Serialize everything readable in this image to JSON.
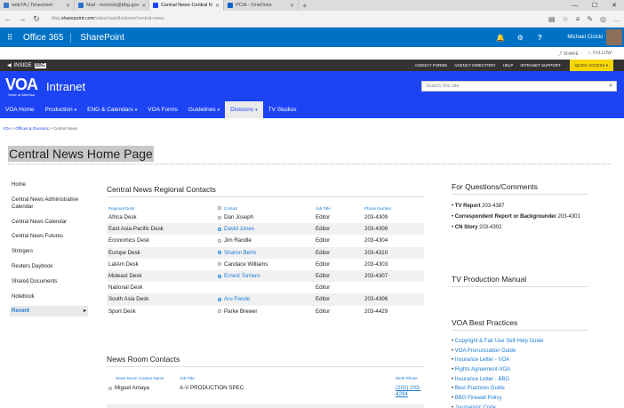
{
  "browser": {
    "tabs": [
      {
        "label": "webTA | Timesheet",
        "color": "#3c78c8"
      },
      {
        "label": "Mail - mcicicki@bbg.gov",
        "color": "#2a6fc9"
      },
      {
        "label": "Central News Central N",
        "color": "#1c44f5",
        "active": true
      },
      {
        "label": "PCIA - OneDrive",
        "color": "#0a64c8"
      }
    ],
    "url_prefix": "bbg.",
    "url_domain": "sharepoint.com",
    "url_path": "/sites/voa/divisions/central-news"
  },
  "o365": {
    "brand": "Office 365",
    "app": "SharePoint",
    "user": "Michael Cicicki"
  },
  "share": {
    "share": "SHARE",
    "follow": "FOLLOW"
  },
  "inside": {
    "logo": "INSIDE",
    "logo_box": "BBG",
    "links": [
      "AGENCY FORMS",
      "AGENCY DIRECTORY",
      "HELP",
      "INTRANET SUPPORT"
    ],
    "quick_access": "QUICK ACCESS"
  },
  "header": {
    "logo_mark": "VOA",
    "logo_sub": "Voice of America",
    "site_title": "Intranet",
    "search_placeholder": "Search this site"
  },
  "nav": [
    {
      "label": "VOA Home",
      "caret": false
    },
    {
      "label": "Production",
      "caret": true
    },
    {
      "label": "ENG & Calendars",
      "caret": true
    },
    {
      "label": "VOA Forms",
      "caret": false
    },
    {
      "label": "Guidelines",
      "caret": true
    },
    {
      "label": "Divisions",
      "caret": true,
      "selected": true
    },
    {
      "label": "TV Studios",
      "caret": false
    }
  ],
  "breadcrumb": {
    "items": [
      "VOA",
      "Offices & Divisions",
      "Central News"
    ],
    "sep": " > "
  },
  "page_title": "Central News Home Page",
  "left_nav": [
    "Home",
    "Central News Administrative Calendar",
    "Central News Calendar",
    "Central News Futures",
    "Stringers",
    "Reuters Daybook",
    "Shared Documents",
    "Notebook",
    "Recent"
  ],
  "regional": {
    "title": "Central News Regional Contacts",
    "headers": [
      "Regional Desk",
      "Contact",
      "Job Title",
      "Phone Number"
    ],
    "rows": [
      {
        "desk": "Africa Desk",
        "contact": "Dan Joseph",
        "link": false,
        "title": "Editor",
        "phone": "203-4309"
      },
      {
        "desk": "East Asia-Pacific Desk",
        "contact": "David Jones",
        "link": true,
        "title": "Editor",
        "phone": "203-4308"
      },
      {
        "desk": "Economics Desk",
        "contact": "Jim Randle",
        "link": false,
        "title": "Editor",
        "phone": "203-4304"
      },
      {
        "desk": "Europe Desk",
        "contact": "Sharon Behn",
        "link": true,
        "title": "Editor",
        "phone": "203-4310"
      },
      {
        "desk": "LatAm Desk",
        "contact": "Candace Williams",
        "link": false,
        "title": "Editor",
        "phone": "203-4303"
      },
      {
        "desk": "Mideast Desk",
        "contact": "Ernest Torriero",
        "link": true,
        "title": "Editor",
        "phone": "203-4307"
      },
      {
        "desk": "National Desk",
        "contact": "",
        "link": false,
        "title": "Editor",
        "phone": ""
      },
      {
        "desk": "South Asia Desk",
        "contact": "Aru Pande",
        "link": true,
        "title": "Editor",
        "phone": "203-4306"
      },
      {
        "desk": "Sport Desk",
        "contact": "Parke Brewer",
        "link": false,
        "title": "Editor",
        "phone": "203-4429"
      }
    ]
  },
  "newsroom": {
    "title": "News Room Contacts",
    "headers": [
      "News Room Contact Name",
      "Job Title",
      "Work Phone"
    ],
    "rows": [
      {
        "name": "Miguel Amaya",
        "title": "A-V PRODUCTION SPEC",
        "phone": "(202) 203-4294"
      }
    ]
  },
  "questions": {
    "title": "For Questions/Comments",
    "items": [
      {
        "label": "TV Report",
        "value": "203-4387"
      },
      {
        "label": "Correspondent Report or Backgrounder",
        "value": "203-4301"
      },
      {
        "label": "CN Story",
        "value": "203-4302"
      }
    ]
  },
  "tv_manual": {
    "title": "TV Production Manual"
  },
  "best_practices": {
    "title": "VOA Best Practices",
    "items": [
      "Copyright & Fair Use Self-Help Guide",
      "VOA Pronunciation Guide",
      "Insurance Letter - VOA",
      "Rights Agreement-VOA",
      "Insurance Letter - BBG",
      "Best Practices Guide",
      "BBG Firewall Policy",
      "Journalistic Code"
    ]
  }
}
